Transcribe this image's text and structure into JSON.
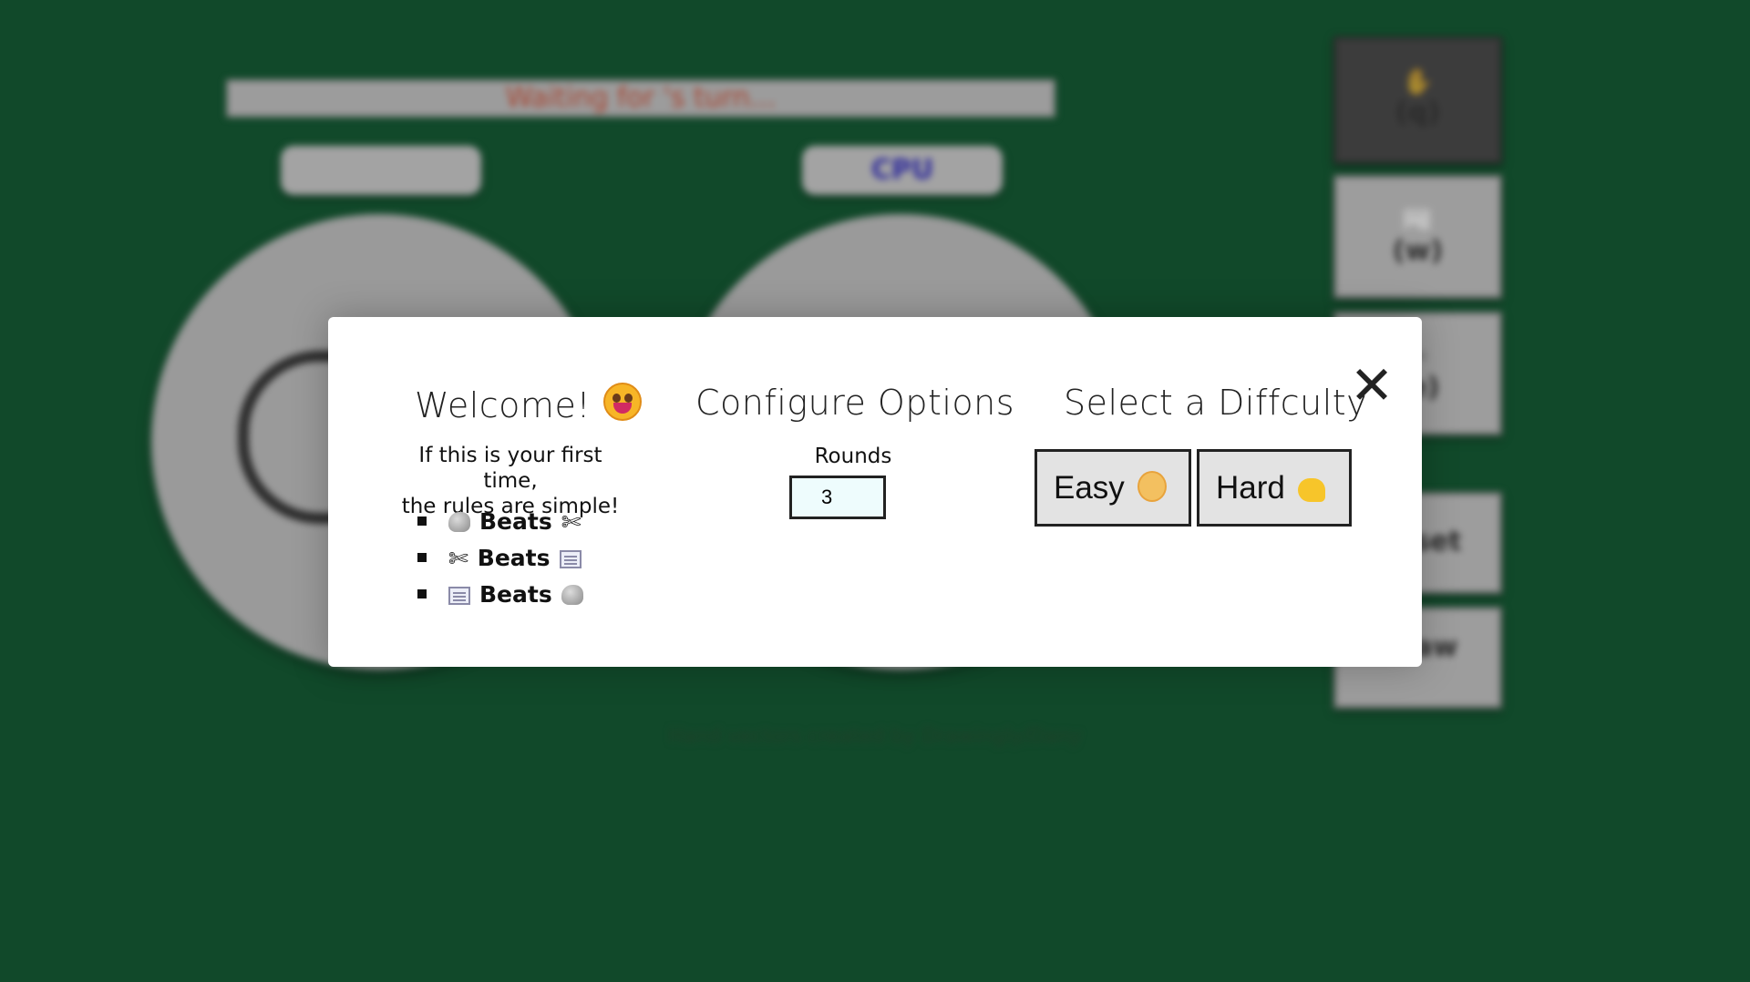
{
  "background": {
    "status_text": "Waiting for 's turn...",
    "player_name": "",
    "cpu_name": "CPU",
    "side_buttons": [
      {
        "glyph": "✋",
        "key": "(q)"
      },
      {
        "glyph": "📰",
        "key": "(w)"
      },
      {
        "glyph": "✂",
        "key": "(e)"
      },
      {
        "glyph": "",
        "key": "Reset"
      },
      {
        "glyph": "",
        "key": "Draw"
      }
    ],
    "credits": "Hand vectors created by Drawingly/Dany"
  },
  "modal": {
    "close_glyph": "✕",
    "welcome": {
      "heading": "Welcome!",
      "intro_line1": "If this is your first time,",
      "intro_line2": "the rules are simple!",
      "rules": [
        {
          "left": "rock",
          "word": "Beats",
          "right": "scissors"
        },
        {
          "left": "scissors",
          "word": "Beats",
          "right": "paper"
        },
        {
          "left": "paper",
          "word": "Beats",
          "right": "rock"
        }
      ]
    },
    "configure": {
      "heading": "Configure Options",
      "rounds_label": "Rounds",
      "rounds_value": "3"
    },
    "difficulty": {
      "heading": "Select a Diffculty",
      "easy_label": "Easy",
      "easy_icon": "baby-emoji",
      "hard_label": "Hard",
      "hard_icon": "flexed-biceps-emoji"
    }
  }
}
